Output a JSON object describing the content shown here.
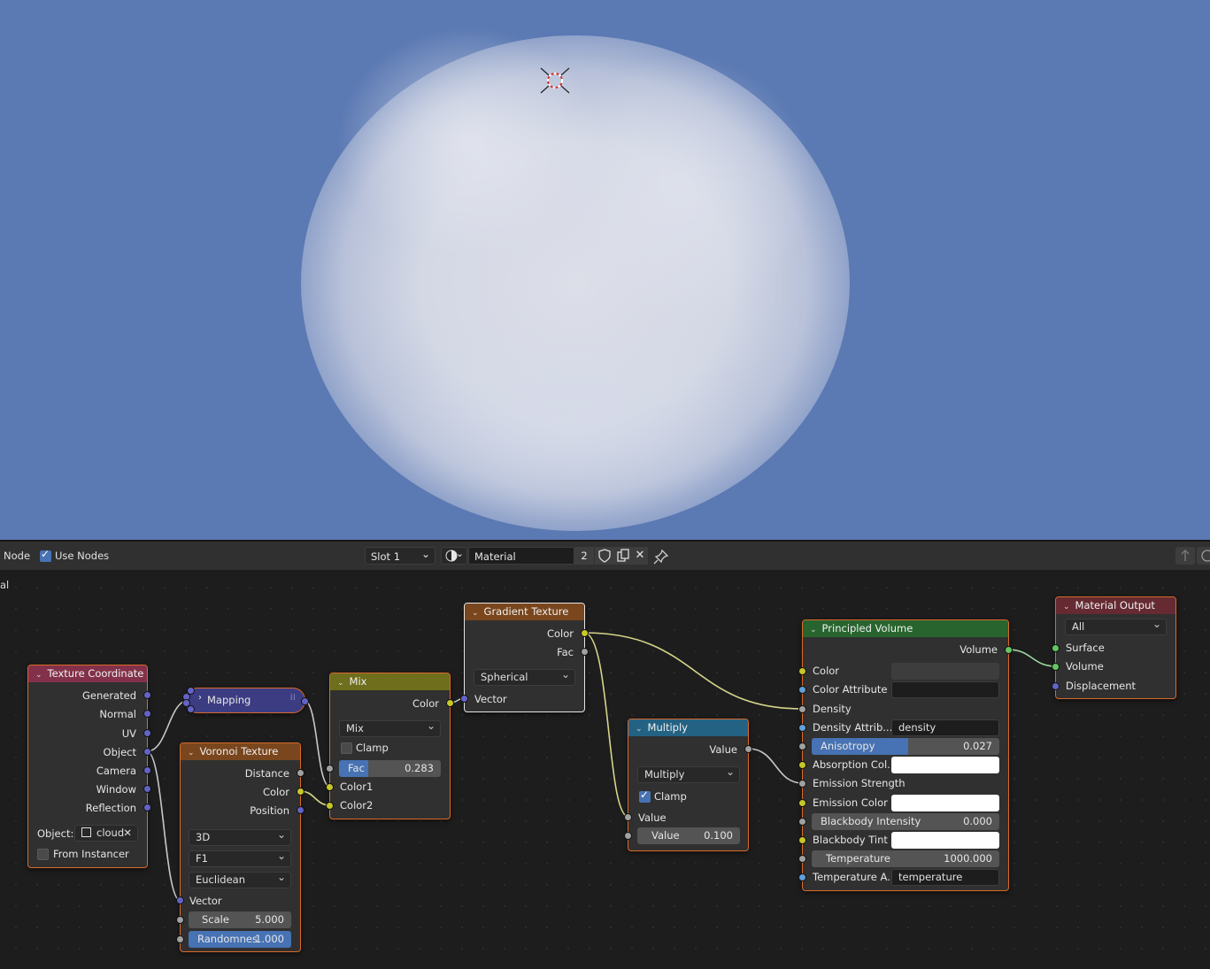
{
  "header": {
    "partial_left_label": "Node",
    "use_nodes_label": "Use Nodes",
    "use_nodes_checked": true,
    "slot": "Slot 1",
    "material_name": "Material",
    "user_count": "2",
    "edge_fragment": "al"
  },
  "nodes": {
    "texture_coordinate": {
      "title": "Texture Coordinate",
      "outputs": [
        "Generated",
        "Normal",
        "UV",
        "Object",
        "Camera",
        "Window",
        "Reflection"
      ],
      "object_label": "Object:",
      "object_value": "cloud",
      "from_instancer_label": "From Instancer",
      "from_instancer_checked": false
    },
    "mapping": {
      "title": "Mapping"
    },
    "voronoi": {
      "title": "Voronoi Texture",
      "outputs": [
        "Distance",
        "Color",
        "Position"
      ],
      "dimensions": "3D",
      "feature": "F1",
      "metric": "Euclidean",
      "vector_label": "Vector",
      "scale_label": "Scale",
      "scale_value": "5.000",
      "randomness_label": "Randomnes",
      "randomness_value": "1.000",
      "randomness_fraction": 1.0
    },
    "mix": {
      "title": "Mix",
      "output": "Color",
      "blend_type": "Mix",
      "clamp_label": "Clamp",
      "clamp_checked": false,
      "fac_label": "Fac",
      "fac_value": "0.283",
      "fac_fraction": 0.283,
      "input1": "Color1",
      "input2": "Color2"
    },
    "gradient": {
      "title": "Gradient Texture",
      "outputs": [
        "Color",
        "Fac"
      ],
      "type": "Spherical",
      "vector_label": "Vector"
    },
    "multiply": {
      "title": "Multiply",
      "output": "Value",
      "operation": "Multiply",
      "clamp_label": "Clamp",
      "clamp_checked": true,
      "input_label": "Value",
      "value_label": "Value",
      "value_value": "0.100"
    },
    "principled_volume": {
      "title": "Principled Volume",
      "output": "Volume",
      "color_label": "Color",
      "color_swatch": "#3d3d3d",
      "color_attribute_label": "Color Attribute",
      "density_label": "Density",
      "density_attribute_label": "Density Attrib...",
      "density_attribute_value": "density",
      "anisotropy_label": "Anisotropy",
      "anisotropy_value": "0.027",
      "anisotropy_fraction": 0.5135,
      "absorption_label": "Absorption Col...",
      "absorption_swatch": "#ffffff",
      "emission_strength_label": "Emission Strength",
      "emission_color_label": "Emission Color",
      "emission_color_swatch": "#ffffff",
      "blackbody_intensity_label": "Blackbody Intensity",
      "blackbody_intensity_value": "0.000",
      "blackbody_tint_label": "Blackbody Tint",
      "blackbody_tint_swatch": "#ffffff",
      "temperature_label": "Temperature",
      "temperature_value": "1000.000",
      "temperature_attribute_label": "Temperature A...",
      "temperature_attribute_value": "temperature"
    },
    "material_output": {
      "title": "Material Output",
      "target": "All",
      "inputs": [
        "Surface",
        "Volume",
        "Displacement"
      ]
    }
  },
  "colors": {
    "viewport_sky": "#5b79b3",
    "accent_blue": "#4772b3",
    "node_border_selected": "#d9692a"
  }
}
